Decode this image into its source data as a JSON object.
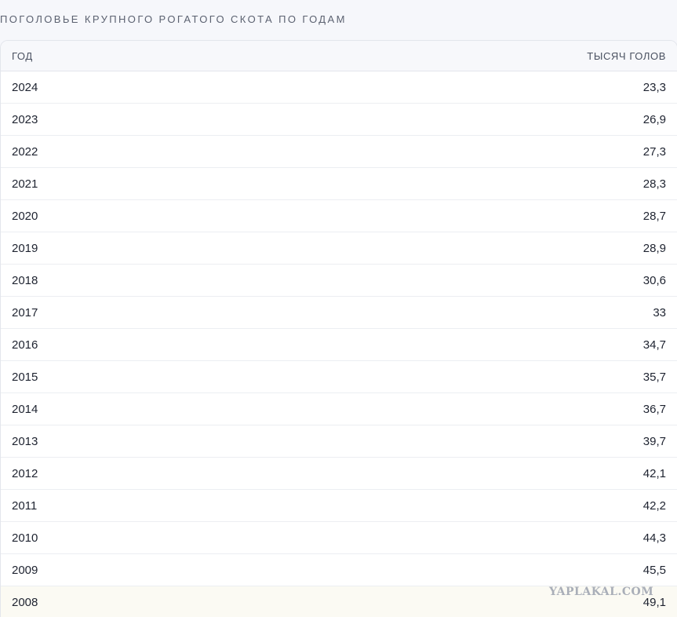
{
  "title": "ПОГОЛОВЬЕ КРУПНОГО РОГАТОГО СКОТА ПО ГОДАМ",
  "table": {
    "headers": [
      "ГОД",
      "ТЫСЯЧ ГОЛОВ"
    ],
    "rows": [
      {
        "year": "2024",
        "value": "23,3"
      },
      {
        "year": "2023",
        "value": "26,9"
      },
      {
        "year": "2022",
        "value": "27,3"
      },
      {
        "year": "2021",
        "value": "28,3"
      },
      {
        "year": "2020",
        "value": "28,7"
      },
      {
        "year": "2019",
        "value": "28,9"
      },
      {
        "year": "2018",
        "value": "30,6"
      },
      {
        "year": "2017",
        "value": "33"
      },
      {
        "year": "2016",
        "value": "34,7"
      },
      {
        "year": "2015",
        "value": "35,7"
      },
      {
        "year": "2014",
        "value": "36,7"
      },
      {
        "year": "2013",
        "value": "39,7"
      },
      {
        "year": "2012",
        "value": "42,1"
      },
      {
        "year": "2011",
        "value": "42,2"
      },
      {
        "year": "2010",
        "value": "44,3"
      },
      {
        "year": "2009",
        "value": "45,5"
      },
      {
        "year": "2008",
        "value": "49,1"
      }
    ]
  },
  "watermark": "YAPLAKAL.COM"
}
